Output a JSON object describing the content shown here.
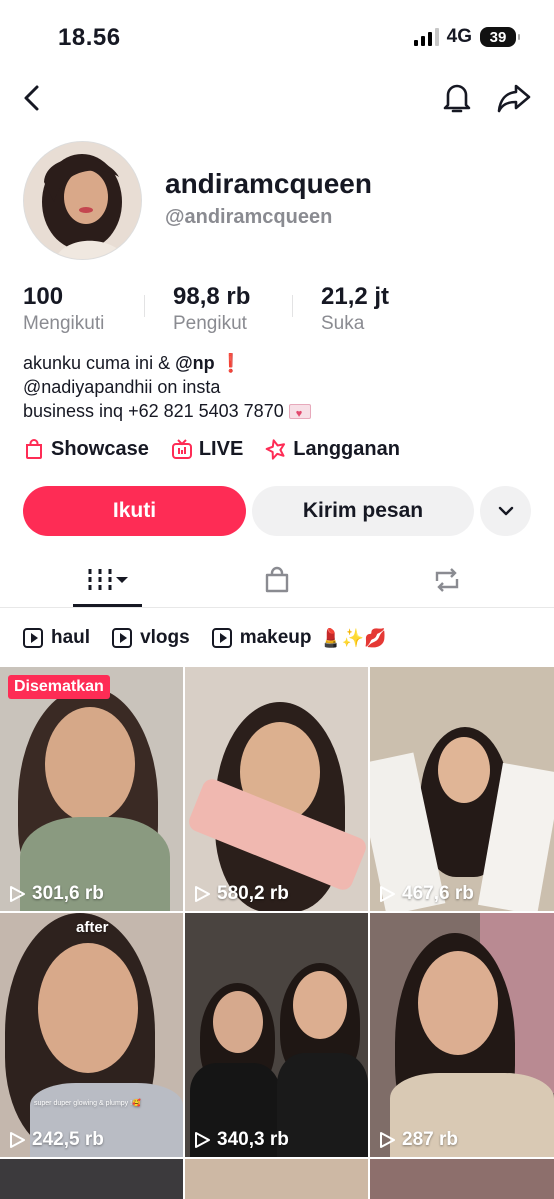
{
  "status_bar": {
    "time": "18.56",
    "network": "4G",
    "battery": "39"
  },
  "profile": {
    "username": "andiramcqueen",
    "handle": "@andiramcqueen",
    "stats": [
      {
        "value": "100",
        "label": "Mengikuti"
      },
      {
        "value": "98,8 rb",
        "label": "Pengikut"
      },
      {
        "value": "21,2 jt",
        "label": "Suka"
      }
    ],
    "bio": {
      "line1_text": "akunku cuma ini & ",
      "line1_mention": "@np",
      "line1_emoji": "❗",
      "line2": "@nadiyapandhii on insta",
      "line3": "business inq +62 821 5403 7870"
    },
    "links": [
      {
        "label": "Showcase",
        "icon": "shopping-bag-icon"
      },
      {
        "label": "LIVE",
        "icon": "live-tv-icon"
      },
      {
        "label": "Langganan",
        "icon": "subscription-star-icon"
      }
    ],
    "buttons": {
      "follow": "Ikuti",
      "message": "Kirim pesan"
    }
  },
  "tabs": [
    {
      "icon": "videos-grid-icon",
      "active": true
    },
    {
      "icon": "shop-bag-icon",
      "active": false
    },
    {
      "icon": "repost-icon",
      "active": false
    }
  ],
  "playlists": [
    {
      "label": "haul"
    },
    {
      "label": "vlogs"
    },
    {
      "label": "makeup",
      "emojis": "💄✨💋"
    }
  ],
  "videos": [
    {
      "views": "301,6 rb",
      "pinned_label": "Disematkan"
    },
    {
      "views": "580,2 rb"
    },
    {
      "views": "467,6 rb"
    },
    {
      "views": "242,5 rb",
      "overlay_title": "after",
      "overlay_caption": "super duper glowing & plumpy !🥰"
    },
    {
      "views": "340,3 rb"
    },
    {
      "views": "287 rb"
    }
  ],
  "colors": {
    "accent": "#fe2c55",
    "text": "#161823",
    "muted": "#8a8b91",
    "surface": "#f1f1f2"
  }
}
